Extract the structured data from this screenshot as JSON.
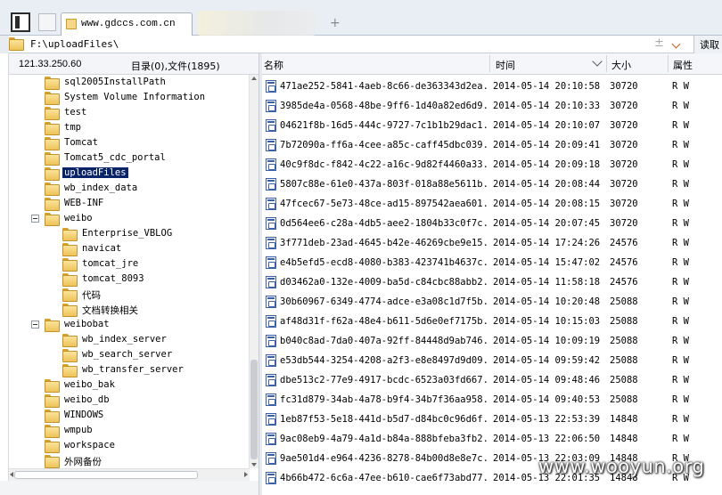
{
  "browser": {
    "active_tab_title": "www.gdccs.com.cn",
    "new_tab_glyph": "+"
  },
  "addressbar": {
    "path": "F:\\uploadFiles\\",
    "plus_glyph": "±",
    "read_button": "读取"
  },
  "info": {
    "ip": "121.33.250.60",
    "counts": "目录(0),文件(1895)"
  },
  "columns": {
    "name": "名称",
    "time": "时间",
    "size": "大小",
    "attr": "属性"
  },
  "tree": [
    {
      "label": "sql2005InstallPath",
      "level": 1
    },
    {
      "label": "System Volume Information",
      "level": 1
    },
    {
      "label": "test",
      "level": 1
    },
    {
      "label": "tmp",
      "level": 1
    },
    {
      "label": "Tomcat",
      "level": 1
    },
    {
      "label": "Tomcat5_cdc_portal",
      "level": 1
    },
    {
      "label": "uploadFiles",
      "level": 1,
      "selected": true
    },
    {
      "label": "wb_index_data",
      "level": 1
    },
    {
      "label": "WEB-INF",
      "level": 1
    },
    {
      "label": "weibo",
      "level": 1,
      "expanded": true
    },
    {
      "label": "Enterprise_VBLOG",
      "level": 2
    },
    {
      "label": "navicat",
      "level": 2
    },
    {
      "label": "tomcat_jre",
      "level": 2
    },
    {
      "label": "tomcat_8093",
      "level": 2
    },
    {
      "label": "代码",
      "level": 2
    },
    {
      "label": "文档转换相关",
      "level": 2
    },
    {
      "label": "weibobat",
      "level": 1,
      "expanded": true
    },
    {
      "label": "wb_index_server",
      "level": 2
    },
    {
      "label": "wb_search_server",
      "level": 2
    },
    {
      "label": "wb_transfer_server",
      "level": 2
    },
    {
      "label": "weibo_bak",
      "level": 1
    },
    {
      "label": "weibo_db",
      "level": 1
    },
    {
      "label": "WINDOWS",
      "level": 1
    },
    {
      "label": "wmpub",
      "level": 1
    },
    {
      "label": "workspace",
      "level": 1
    },
    {
      "label": "外网备份",
      "level": 1
    }
  ],
  "files": [
    {
      "name": "471ae252-5841-4aeb-8c66-de363343d2ea...",
      "time": "2014-05-14 20:10:58",
      "size": "30720",
      "attr": "R W"
    },
    {
      "name": "3985de4a-0568-48be-9ff6-1d40a82ed6d9...",
      "time": "2014-05-14 20:10:33",
      "size": "30720",
      "attr": "R W"
    },
    {
      "name": "04621f8b-16d5-444c-9727-7c1b1b29dac1...",
      "time": "2014-05-14 20:10:07",
      "size": "30720",
      "attr": "R W"
    },
    {
      "name": "7b72090a-ff6a-4cee-a85c-caff45dbc039...",
      "time": "2014-05-14 20:09:41",
      "size": "30720",
      "attr": "R W"
    },
    {
      "name": "40c9f8dc-f842-4c22-a16c-9d82f4460a33...",
      "time": "2014-05-14 20:09:18",
      "size": "30720",
      "attr": "R W"
    },
    {
      "name": "5807c88e-61e0-437a-803f-018a88e5611b...",
      "time": "2014-05-14 20:08:44",
      "size": "30720",
      "attr": "R W"
    },
    {
      "name": "47fcec67-5e73-48ce-ad15-897542aea601...",
      "time": "2014-05-14 20:08:15",
      "size": "30720",
      "attr": "R W"
    },
    {
      "name": "0d564ee6-c28a-4db5-aee2-1804b33c0f7c...",
      "time": "2014-05-14 20:07:45",
      "size": "30720",
      "attr": "R W"
    },
    {
      "name": "3f771deb-23ad-4645-b42e-46269cbe9e15...",
      "time": "2014-05-14 17:24:26",
      "size": "24576",
      "attr": "R W"
    },
    {
      "name": "e4b5efd5-ecd8-4080-b383-423741b4637c...",
      "time": "2014-05-14 15:47:02",
      "size": "24576",
      "attr": "R W"
    },
    {
      "name": "d03462a0-132e-4009-ba5d-c84cbc88abb2...",
      "time": "2014-05-14 11:58:18",
      "size": "24576",
      "attr": "R W"
    },
    {
      "name": "30b60967-6349-4774-adce-e3a08c1d7f5b...",
      "time": "2014-05-14 10:20:48",
      "size": "25088",
      "attr": "R W"
    },
    {
      "name": "af48d31f-f62a-48e4-b611-5d6e0ef7175b...",
      "time": "2014-05-14 10:15:03",
      "size": "25088",
      "attr": "R W"
    },
    {
      "name": "b040c8ad-7da0-407a-92ff-84448d9ab746...",
      "time": "2014-05-14 10:09:19",
      "size": "25088",
      "attr": "R W"
    },
    {
      "name": "e53db544-3254-4208-a2f3-e8e8497d9d09...",
      "time": "2014-05-14 09:59:42",
      "size": "25088",
      "attr": "R W"
    },
    {
      "name": "dbe513c2-77e9-4917-bcdc-6523a03fd667...",
      "time": "2014-05-14 09:48:46",
      "size": "25088",
      "attr": "R W"
    },
    {
      "name": "fc31d879-34ab-4a78-b9f4-34b7f36aa958...",
      "time": "2014-05-14 09:40:53",
      "size": "25088",
      "attr": "R W"
    },
    {
      "name": "1eb87f53-5e18-441d-b5d7-d84bc0c96d6f...",
      "time": "2014-05-13 22:53:39",
      "size": "14848",
      "attr": "R W"
    },
    {
      "name": "9ac08eb9-4a79-4a1d-b84a-888bfeba3fb2...",
      "time": "2014-05-13 22:06:50",
      "size": "14848",
      "attr": "R W"
    },
    {
      "name": "9ae501d4-e964-4236-8278-84b00d8e8e7c...",
      "time": "2014-05-13 22:03:09",
      "size": "14848",
      "attr": "R W"
    },
    {
      "name": "4b66b472-6c6a-47ee-b610-cae6f73abd77...",
      "time": "2014-05-13 22:01:35",
      "size": "14848",
      "attr": "R W"
    }
  ],
  "watermark": "www.wooyun.org"
}
